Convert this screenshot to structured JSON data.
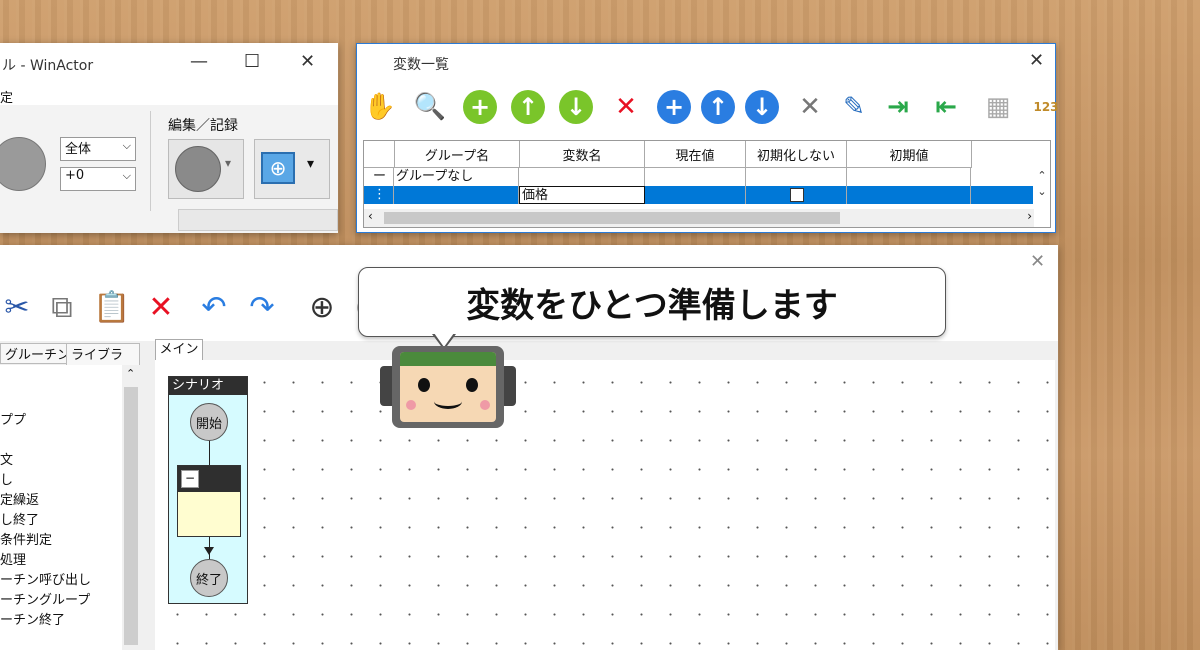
{
  "main_window": {
    "title": "ル - WinActor",
    "menu": "定",
    "ribbon": {
      "group_label": "編集／記録",
      "dropdown1": "全体",
      "dropdown2": "+0"
    }
  },
  "var_window": {
    "title": "変数一覧",
    "columns": [
      "グループ名",
      "変数名",
      "現在値",
      "初期化しない",
      "初期値"
    ],
    "rows": [
      {
        "marker": "ー",
        "group": "グループなし",
        "name": "",
        "current": "",
        "no_init": "",
        "initial": ""
      },
      {
        "marker": "⋮",
        "group": "",
        "name": "価格",
        "current": "",
        "no_init": "□",
        "initial": "",
        "selected": true
      }
    ]
  },
  "flow_window": {
    "left_tabs": [
      "グルーチン",
      "ライブラリ"
    ],
    "tree_items": [
      "ププ",
      "",
      "文",
      "し",
      "定繰返",
      "し終了",
      "条件判定",
      "処理",
      "ーチン呼び出し",
      "ーチングループ",
      "ーチン終了"
    ],
    "canvas_tab": "メイン",
    "scenario": {
      "title": "シナリオ",
      "start": "開始",
      "end": "終了",
      "minus": "−"
    }
  },
  "callout": {
    "text": "変数をひとつ準備します"
  },
  "colors": {
    "selected_row": "#0078d7",
    "green": "#7ac52a",
    "blue": "#2a7de1",
    "red": "#e81123",
    "flow_node": "#c8c8c8",
    "scenario_bg": "#d6fbff"
  }
}
